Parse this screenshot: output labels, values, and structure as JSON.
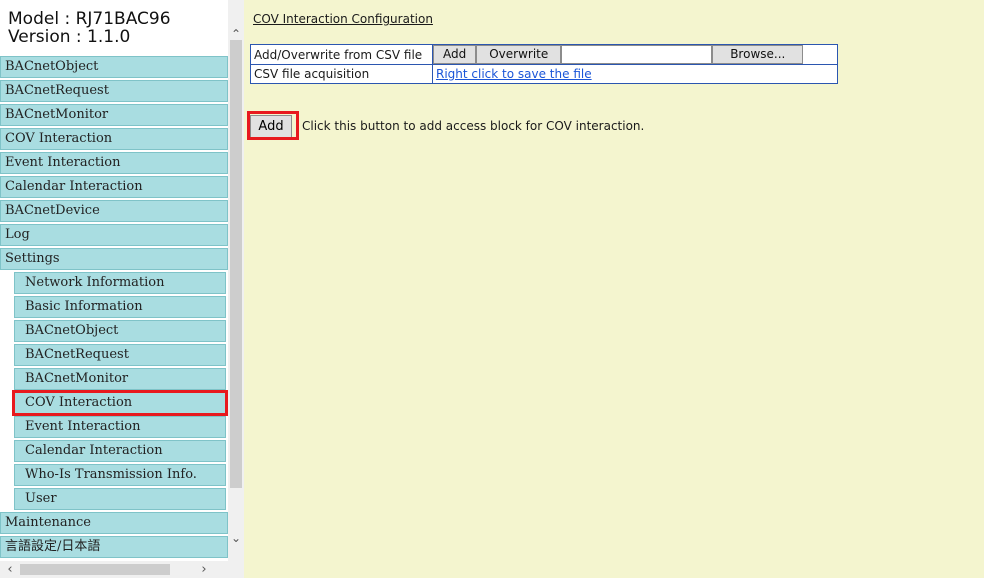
{
  "nav": {
    "model_line": "Model : RJ71BAC96",
    "version_line": "Version : 1.1.0",
    "items": [
      {
        "label": "BACnetObject",
        "level": 1
      },
      {
        "label": "BACnetRequest",
        "level": 1
      },
      {
        "label": "BACnetMonitor",
        "level": 1
      },
      {
        "label": "COV Interaction",
        "level": 1
      },
      {
        "label": "Event Interaction",
        "level": 1
      },
      {
        "label": "Calendar Interaction",
        "level": 1
      },
      {
        "label": "BACnetDevice",
        "level": 1
      },
      {
        "label": "Log",
        "level": 1
      },
      {
        "label": "Settings",
        "level": 1
      },
      {
        "label": "Network Information",
        "level": 2
      },
      {
        "label": "Basic Information",
        "level": 2
      },
      {
        "label": "BACnetObject",
        "level": 2
      },
      {
        "label": "BACnetRequest",
        "level": 2
      },
      {
        "label": "BACnetMonitor",
        "level": 2
      },
      {
        "label": "COV Interaction",
        "level": 2,
        "active": true
      },
      {
        "label": "Event Interaction",
        "level": 2
      },
      {
        "label": "Calendar Interaction",
        "level": 2
      },
      {
        "label": "Who-Is Transmission Info.",
        "level": 2
      },
      {
        "label": "User",
        "level": 2
      },
      {
        "label": "Maintenance",
        "level": 1
      },
      {
        "label": "言語設定/日本語",
        "level": 1
      }
    ],
    "scroll_up_icon": "chevron-up-icon",
    "scroll_down_icon": "chevron-down-icon",
    "scroll_left_icon": "chevron-left-icon",
    "scroll_right_icon": "chevron-right-icon"
  },
  "main": {
    "title": "COV Interaction Configuration",
    "csv_table": {
      "row1_label": "Add/Overwrite from CSV file",
      "add_label": "Add",
      "overwrite_label": "Overwrite",
      "file_value": "",
      "browse_label": "Browse...",
      "row2_label": "CSV file acquisition",
      "save_link": "Right click to save the file"
    },
    "add_button_label": "Add",
    "add_description": "Click this button to add access block for COV interaction."
  },
  "colors": {
    "menu_bg": "#a9dde1",
    "content_bg": "#f4f5cf",
    "highlight": "#e8191e",
    "link": "#1a55d8",
    "table_border": "#2b56b0"
  }
}
